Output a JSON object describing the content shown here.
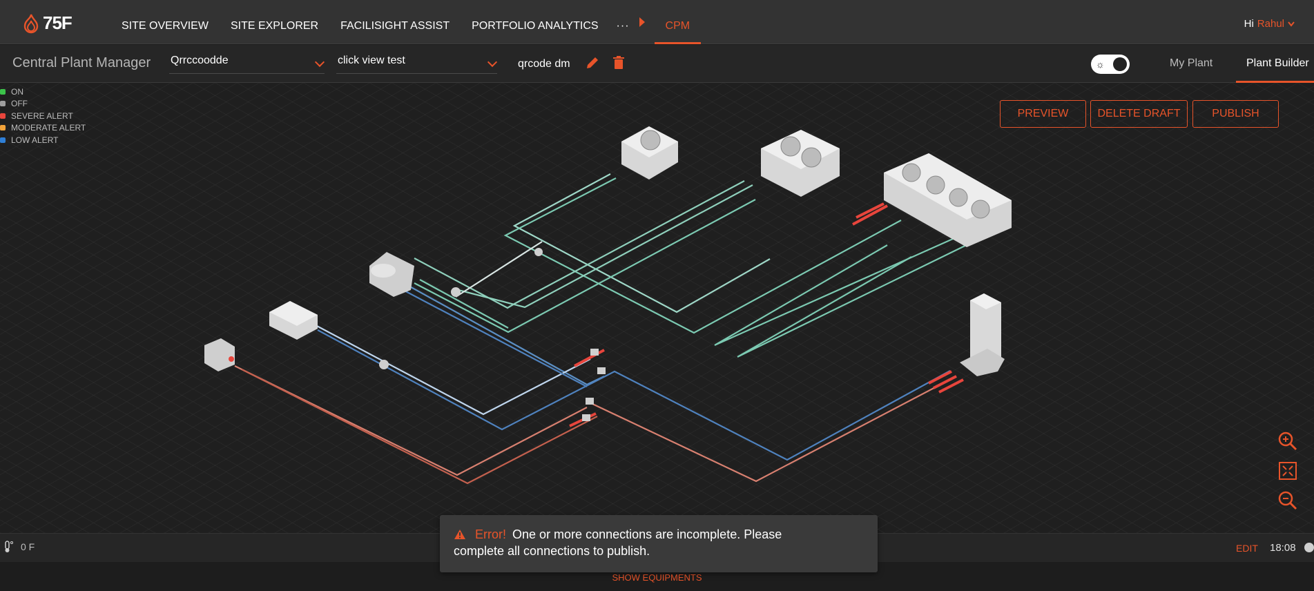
{
  "brand": {
    "logo_text": "75F",
    "accent": "#e8542a"
  },
  "nav": {
    "items": [
      "SITE OVERVIEW",
      "SITE EXPLORER",
      "FACILISIGHT ASSIST",
      "PORTFOLIO ANALYTICS"
    ],
    "more": "···",
    "active": "CPM"
  },
  "user": {
    "greeting": "Hi",
    "name": "Rahul"
  },
  "subheader": {
    "title": "Central Plant Manager",
    "site_select": "Qrrccoodde",
    "view_select": "click view test",
    "draft_name": "qrcode dm",
    "tabs": {
      "my_plant": "My Plant",
      "plant_builder": "Plant Builder"
    }
  },
  "legend": [
    {
      "label": "ON",
      "color": "#3cc34a"
    },
    {
      "label": "OFF",
      "color": "#9e9e9e"
    },
    {
      "label": "SEVERE ALERT",
      "color": "#e8453c"
    },
    {
      "label": "MODERATE ALERT",
      "color": "#f2a33a"
    },
    {
      "label": "LOW ALERT",
      "color": "#2f7fd6"
    }
  ],
  "actions": {
    "preview": "PREVIEW",
    "delete_draft": "DELETE DRAFT",
    "publish": "PUBLISH"
  },
  "status": {
    "temperature": "0 F",
    "edit": "EDIT",
    "time": "18:08"
  },
  "footer": {
    "show_equipments": "SHOW EQUIPMENTS"
  },
  "toast": {
    "title": "Error!",
    "line1": "One or more connections are incomplete. Please",
    "line2": "complete all connections to publish."
  }
}
